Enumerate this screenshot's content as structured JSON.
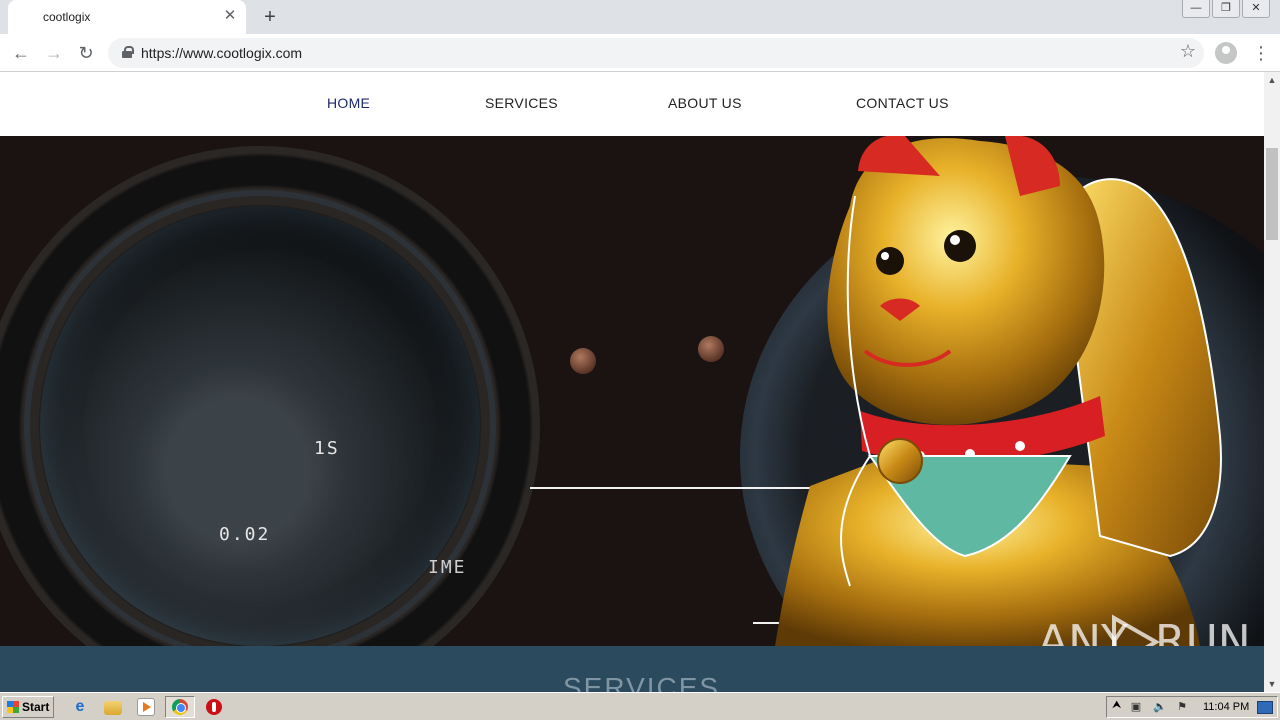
{
  "browser": {
    "tab_title": "cootlogix",
    "tab_close": "✕",
    "new_tab": "+",
    "url": "https://www.cootlogix.com",
    "window_controls": {
      "minimize": "—",
      "restore": "❐",
      "close": "✕"
    },
    "back": "←",
    "forward": "→",
    "reload": "↻",
    "star": "☆",
    "menu": "⋮"
  },
  "site": {
    "nav": [
      {
        "label": "HOME",
        "active": true
      },
      {
        "label": "SERVICES",
        "active": false
      },
      {
        "label": "ABOUT US",
        "active": false
      },
      {
        "label": "CONTACT US",
        "active": false
      }
    ],
    "hero_overlay": [
      "1S",
      "0.02",
      "IME"
    ],
    "services_heading": "SERVICES",
    "colors": {
      "nav_active": "#1b2a6b",
      "services_band": "#2b4a5e"
    }
  },
  "watermark": {
    "left": "ANY",
    "right": "RUN"
  },
  "scrollbar": {
    "up": "▲",
    "down": "▼"
  },
  "taskbar": {
    "start": "Start",
    "tray_arrow": "⮝",
    "clock": "11:04 PM",
    "icons": [
      "internet-explorer-icon",
      "folder-icon",
      "media-player-icon",
      "chrome-icon",
      "opera-icon"
    ]
  }
}
